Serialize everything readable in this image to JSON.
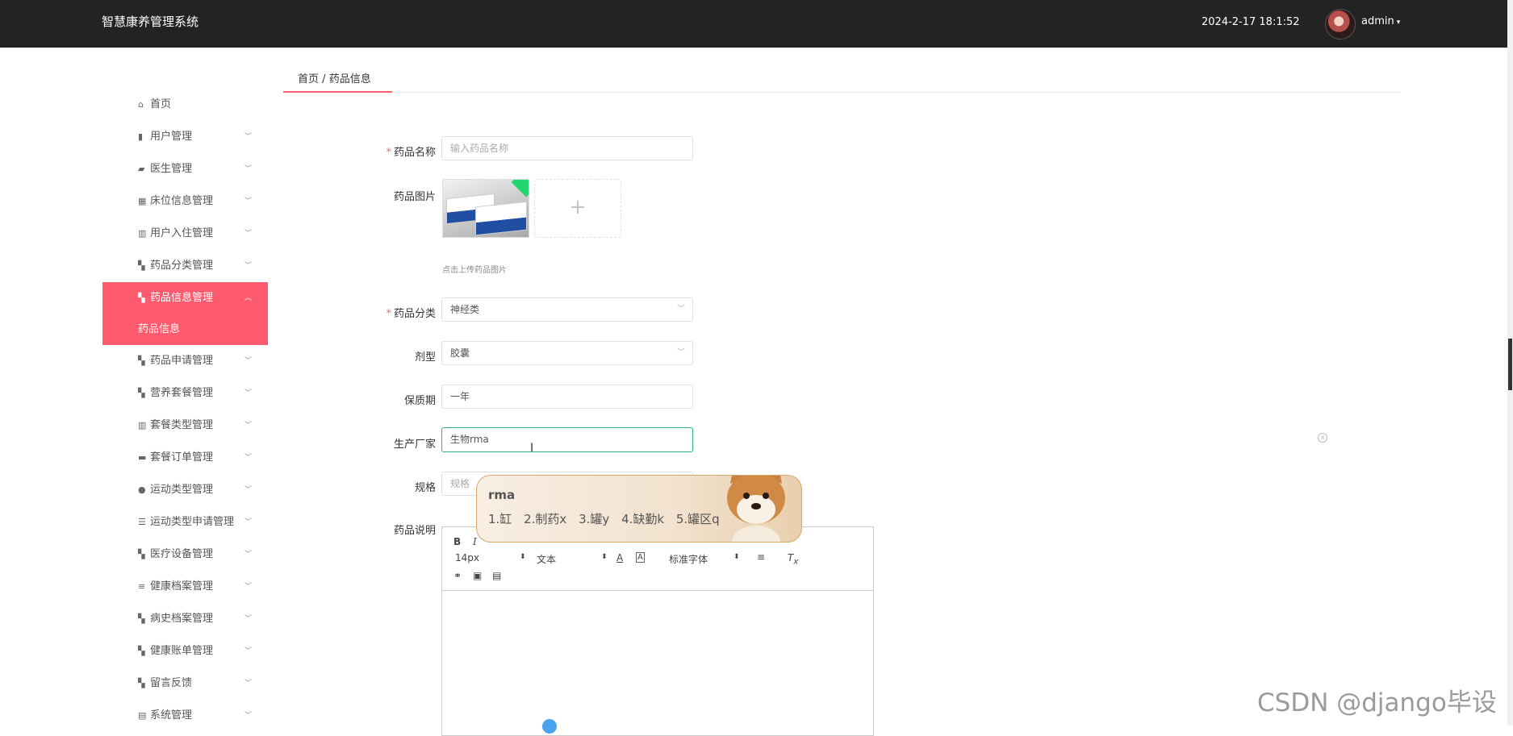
{
  "header": {
    "title": "智慧康养管理系统",
    "datetime": "2024-2-17 18:1:52",
    "username": "admin"
  },
  "sidebar": {
    "items": [
      {
        "label": "首页",
        "icon": "home-icon",
        "expandable": false
      },
      {
        "label": "用户管理",
        "icon": "user-icon",
        "expandable": true
      },
      {
        "label": "医生管理",
        "icon": "thumb-icon",
        "expandable": true
      },
      {
        "label": "床位信息管理",
        "icon": "grid-icon",
        "expandable": true
      },
      {
        "label": "用户入住管理",
        "icon": "bar-chart-icon",
        "expandable": true
      },
      {
        "label": "药品分类管理",
        "icon": "apps-icon",
        "expandable": true
      },
      {
        "label": "药品信息管理",
        "icon": "apps-icon",
        "expandable": true,
        "active": true
      },
      {
        "label": "药品申请管理",
        "icon": "apps-icon",
        "expandable": true
      },
      {
        "label": "营养套餐管理",
        "icon": "apps-icon",
        "expandable": true
      },
      {
        "label": "套餐类型管理",
        "icon": "bar-chart-icon",
        "expandable": true
      },
      {
        "label": "套餐订单管理",
        "icon": "briefcase-icon",
        "expandable": true
      },
      {
        "label": "运动类型管理",
        "icon": "person-icon",
        "expandable": true
      },
      {
        "label": "运动类型申请管理",
        "icon": "sliders-icon",
        "expandable": true
      },
      {
        "label": "医疗设备管理",
        "icon": "apps-icon",
        "expandable": true
      },
      {
        "label": "健康档案管理",
        "icon": "list-icon",
        "expandable": true
      },
      {
        "label": "病史档案管理",
        "icon": "apps-icon",
        "expandable": true
      },
      {
        "label": "健康账单管理",
        "icon": "apps-icon",
        "expandable": true
      },
      {
        "label": "留言反馈",
        "icon": "apps-icon",
        "expandable": true
      },
      {
        "label": "系统管理",
        "icon": "doc-icon",
        "expandable": true
      }
    ],
    "active_sub": "药品信息"
  },
  "breadcrumb": {
    "home": "首页",
    "sep": "/",
    "current": "药品信息"
  },
  "form": {
    "name_label": "药品名称",
    "name_placeholder": "输入药品名称",
    "image_label": "药品图片",
    "upload_hint": "点击上传药品图片",
    "category_label": "药品分类",
    "category_value": "神经类",
    "dosage_label": "剂型",
    "dosage_value": "胶囊",
    "shelf_label": "保质期",
    "shelf_value": "一年",
    "maker_label": "生产厂家",
    "maker_value": "生物rma",
    "spec_label": "规格",
    "spec_placeholder": "规格",
    "desc_label": "药品说明"
  },
  "editor": {
    "bold": "B",
    "italic": "I",
    "font_size": "14px",
    "paragraph": "文本",
    "font_family": "标准字体"
  },
  "ime": {
    "code": "rma",
    "candidates": [
      "1.缸",
      "2.制药x",
      "3.罐y",
      "4.缺勤k",
      "5.罐区q"
    ]
  },
  "watermark": "CSDN @django毕设",
  "colors": {
    "accent": "#ff5a6e",
    "topbar": "#232323",
    "focus": "#2ab483"
  }
}
